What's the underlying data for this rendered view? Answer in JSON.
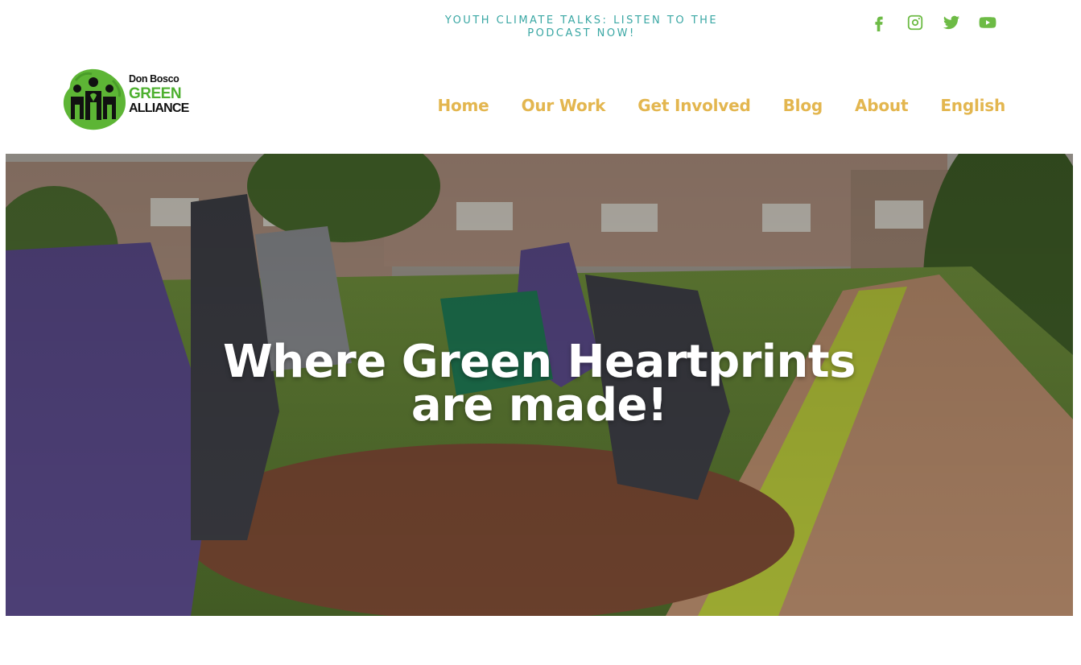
{
  "topbar": {
    "promo_text": "YOUTH CLIMATE TALKS: LISTEN TO THE PODCAST NOW!",
    "social": [
      {
        "icon": "facebook-icon"
      },
      {
        "icon": "instagram-icon"
      },
      {
        "icon": "twitter-icon"
      },
      {
        "icon": "youtube-icon"
      }
    ]
  },
  "logo": {
    "line1": "Don Bosco",
    "line2": "GREEN",
    "line3": "ALLIANCE"
  },
  "nav": {
    "items": [
      {
        "label": "Home"
      },
      {
        "label": "Our Work"
      },
      {
        "label": "Get Involved"
      },
      {
        "label": "Blog"
      },
      {
        "label": "About"
      },
      {
        "label": "English"
      }
    ]
  },
  "hero": {
    "title": "Where Green Heartprints are made!"
  },
  "colors": {
    "accent_green": "#6dbb45",
    "nav_gold": "#e3b64f",
    "promo_teal": "#3aa7a4",
    "logo_green": "#4db02f"
  }
}
